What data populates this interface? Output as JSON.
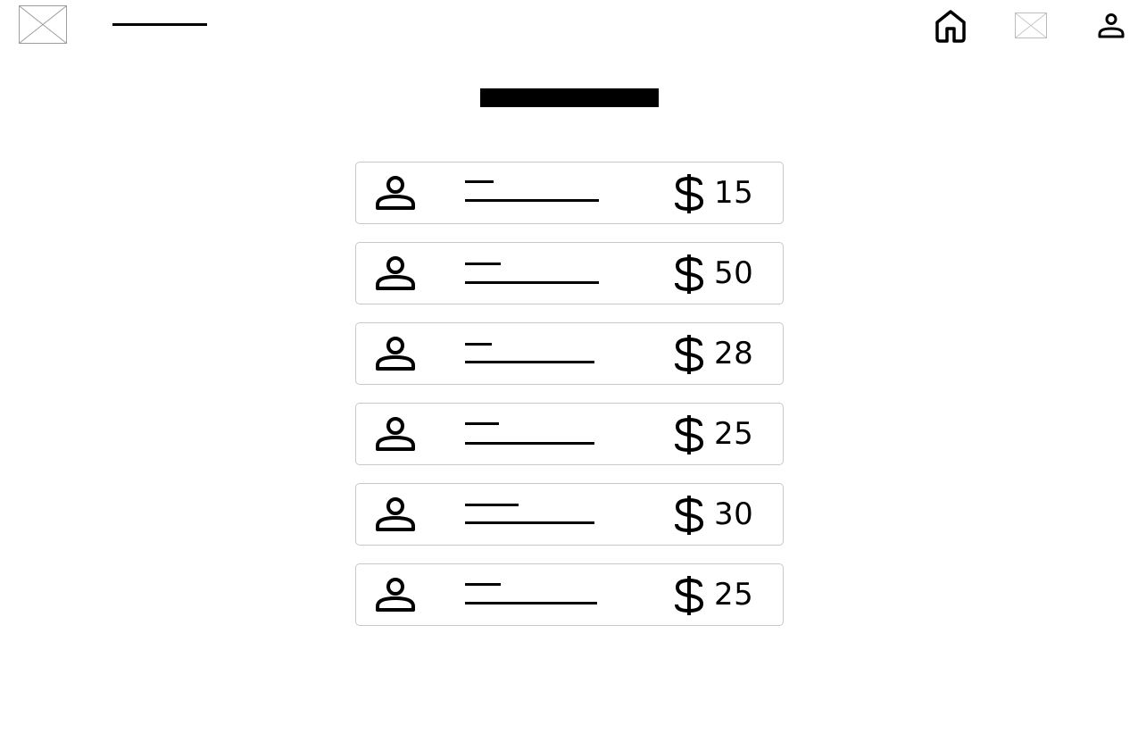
{
  "header": {
    "logo_icon": "image-placeholder-icon",
    "nav": {
      "home_icon": "home-icon",
      "image_icon": "image-placeholder-icon",
      "profile_icon": "person-icon"
    }
  },
  "list": {
    "items": [
      {
        "avatar_icon": "person-icon",
        "currency_icon": "dollar-icon",
        "price": "15"
      },
      {
        "avatar_icon": "person-icon",
        "currency_icon": "dollar-icon",
        "price": "50"
      },
      {
        "avatar_icon": "person-icon",
        "currency_icon": "dollar-icon",
        "price": "28"
      },
      {
        "avatar_icon": "person-icon",
        "currency_icon": "dollar-icon",
        "price": "25"
      },
      {
        "avatar_icon": "person-icon",
        "currency_icon": "dollar-icon",
        "price": "30"
      },
      {
        "avatar_icon": "person-icon",
        "currency_icon": "dollar-icon",
        "price": "25"
      }
    ]
  },
  "colors": {
    "foreground": "#000000",
    "background": "#ffffff",
    "card_border": "#c8c8c8",
    "placeholder_border": "#9e9e9e"
  }
}
